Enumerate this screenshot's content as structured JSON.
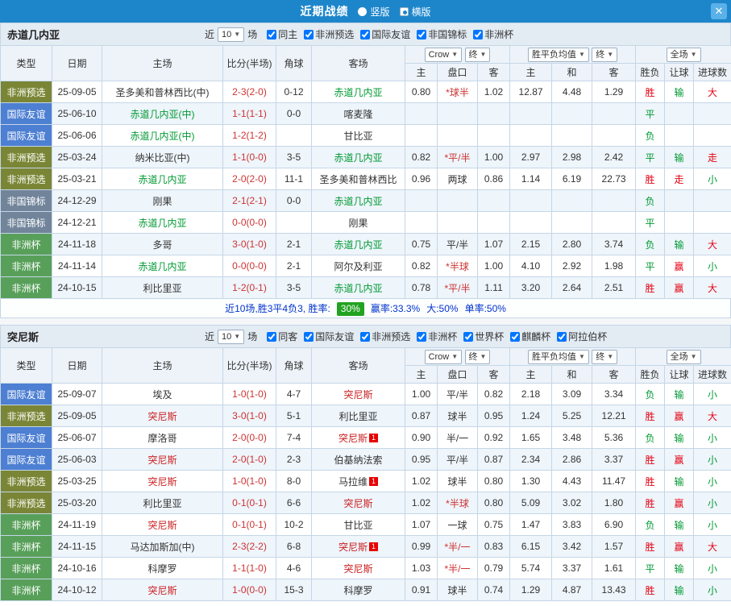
{
  "titlebar": {
    "title": "近期战绩",
    "layout_vertical": "竖版",
    "layout_horizontal": "横版",
    "close_icon": "✕"
  },
  "icons": {
    "caret": "▼"
  },
  "filter_bar": {
    "near": "近",
    "games": "场"
  },
  "head_controls": {
    "company": "Crow",
    "final_a": "终",
    "avg": "胜平负均值",
    "final_b": "终",
    "scope": "全场"
  },
  "table_head": {
    "type": "类型",
    "date": "日期",
    "home": "主场",
    "score": "比分(半场)",
    "corner": "角球",
    "away": "客场",
    "odds_home": "主",
    "odds_line": "盘口",
    "odds_away": "客",
    "euro_home": "主",
    "euro_draw": "和",
    "euro_away": "客",
    "result": "胜负",
    "handicap": "让球",
    "goals": "进球数"
  },
  "type_colors": {
    "非洲预选": "#7a8636",
    "国际友谊": "#4d7fd2",
    "非国锦标": "#71849a",
    "非洲杯": "#58a05a"
  },
  "result_colors": {
    "r": "#e60012",
    "g": "#009933"
  },
  "sections": [
    {
      "team": "赤道几内亚",
      "team_color": "#009933",
      "near_count": "10",
      "filters": [
        {
          "label": "同主",
          "checked": true
        },
        {
          "label": "非洲预选",
          "checked": true
        },
        {
          "label": "国际友谊",
          "checked": true
        },
        {
          "label": "非国锦标",
          "checked": true
        },
        {
          "label": "非洲杯",
          "checked": true
        }
      ],
      "rows": [
        {
          "type": "非洲预选",
          "date": "25-09-05",
          "home": "圣多美和普林西比(中)",
          "score": "2-3(2-0)",
          "corner": "0-12",
          "away": "赤道几内亚",
          "away_focal": true,
          "o1": "0.80",
          "line": "*球半",
          "line_red": true,
          "o2": "1.02",
          "e1": "12.87",
          "e2": "4.48",
          "e3": "1.29",
          "res": "胜",
          "res_c": "r",
          "handi": "输",
          "handi_c": "g",
          "goal": "大",
          "goal_c": "r"
        },
        {
          "type": "国际友谊",
          "date": "25-06-10",
          "home": "赤道几内亚(中)",
          "home_focal": true,
          "score": "1-1(1-1)",
          "corner": "0-0",
          "away": "喀麦隆",
          "o1": "",
          "line": "",
          "o2": "",
          "e1": "",
          "e2": "",
          "e3": "",
          "res": "平",
          "res_c": "g",
          "handi": "",
          "goal": ""
        },
        {
          "type": "国际友谊",
          "date": "25-06-06",
          "home": "赤道几内亚(中)",
          "home_focal": true,
          "score": "1-2(1-2)",
          "corner": "",
          "away": "甘比亚",
          "o1": "",
          "line": "",
          "o2": "",
          "e1": "",
          "e2": "",
          "e3": "",
          "res": "负",
          "res_c": "g",
          "handi": "",
          "goal": ""
        },
        {
          "type": "非洲预选",
          "date": "25-03-24",
          "home": "纳米比亚(中)",
          "score": "1-1(0-0)",
          "corner": "3-5",
          "away": "赤道几内亚",
          "away_focal": true,
          "o1": "0.82",
          "line": "*平/半",
          "line_red": true,
          "o2": "1.00",
          "e1": "2.97",
          "e2": "2.98",
          "e3": "2.42",
          "res": "平",
          "res_c": "g",
          "handi": "输",
          "handi_c": "g",
          "goal": "走",
          "goal_c": "r"
        },
        {
          "type": "非洲预选",
          "date": "25-03-21",
          "home": "赤道几内亚",
          "home_focal": true,
          "score": "2-0(2-0)",
          "corner": "11-1",
          "away": "圣多美和普林西比",
          "o1": "0.96",
          "line": "两球",
          "o2": "0.86",
          "e1": "1.14",
          "e2": "6.19",
          "e3": "22.73",
          "res": "胜",
          "res_c": "r",
          "handi": "走",
          "handi_c": "r",
          "goal": "小",
          "goal_c": "g"
        },
        {
          "type": "非国锦标",
          "date": "24-12-29",
          "home": "刚果",
          "score": "2-1(2-1)",
          "corner": "0-0",
          "away": "赤道几内亚",
          "away_focal": true,
          "o1": "",
          "line": "",
          "o2": "",
          "e1": "",
          "e2": "",
          "e3": "",
          "res": "负",
          "res_c": "g",
          "handi": "",
          "goal": ""
        },
        {
          "type": "非国锦标",
          "date": "24-12-21",
          "home": "赤道几内亚",
          "home_focal": true,
          "score": "0-0(0-0)",
          "corner": "",
          "away": "刚果",
          "o1": "",
          "line": "",
          "o2": "",
          "e1": "",
          "e2": "",
          "e3": "",
          "res": "平",
          "res_c": "g",
          "handi": "",
          "goal": ""
        },
        {
          "type": "非洲杯",
          "date": "24-11-18",
          "home": "多哥",
          "score": "3-0(1-0)",
          "corner": "2-1",
          "away": "赤道几内亚",
          "away_focal": true,
          "o1": "0.75",
          "line": "平/半",
          "o2": "1.07",
          "e1": "2.15",
          "e2": "2.80",
          "e3": "3.74",
          "res": "负",
          "res_c": "g",
          "handi": "输",
          "handi_c": "g",
          "goal": "大",
          "goal_c": "r"
        },
        {
          "type": "非洲杯",
          "date": "24-11-14",
          "home": "赤道几内亚",
          "home_focal": true,
          "score": "0-0(0-0)",
          "corner": "2-1",
          "away": "阿尔及利亚",
          "o1": "0.82",
          "line": "*半球",
          "line_red": true,
          "o2": "1.00",
          "e1": "4.10",
          "e2": "2.92",
          "e3": "1.98",
          "res": "平",
          "res_c": "g",
          "handi": "赢",
          "handi_c": "r",
          "goal": "小",
          "goal_c": "g"
        },
        {
          "type": "非洲杯",
          "date": "24-10-15",
          "home": "利比里亚",
          "score": "1-2(0-1)",
          "corner": "3-5",
          "away": "赤道几内亚",
          "away_focal": true,
          "o1": "0.78",
          "line": "*平/半",
          "line_red": true,
          "o2": "1.11",
          "e1": "3.20",
          "e2": "2.64",
          "e3": "2.51",
          "res": "胜",
          "res_c": "r",
          "handi": "赢",
          "handi_c": "r",
          "goal": "大",
          "goal_c": "r"
        }
      ],
      "summary": {
        "record": "近10场,胜3平4负3, 胜率:",
        "win_rate": "30%",
        "odds_rate": "赢率:33.3%",
        "big_rate": "大:50%",
        "single_rate": "单率:50%"
      }
    },
    {
      "team": "突尼斯",
      "team_color": "#cc2222",
      "near_count": "10",
      "filters": [
        {
          "label": "同客",
          "checked": true
        },
        {
          "label": "国际友谊",
          "checked": true
        },
        {
          "label": "非洲预选",
          "checked": true
        },
        {
          "label": "非洲杯",
          "checked": true
        },
        {
          "label": "世界杯",
          "checked": true
        },
        {
          "label": "麒麟杯",
          "checked": true
        },
        {
          "label": "阿拉伯杯",
          "checked": true
        }
      ],
      "rows": [
        {
          "type": "国际友谊",
          "date": "25-09-07",
          "home": "埃及",
          "score": "1-0(1-0)",
          "corner": "4-7",
          "away": "突尼斯",
          "away_focal": true,
          "o1": "1.00",
          "line": "平/半",
          "o2": "0.82",
          "e1": "2.18",
          "e2": "3.09",
          "e3": "3.34",
          "res": "负",
          "res_c": "g",
          "handi": "输",
          "handi_c": "g",
          "goal": "小",
          "goal_c": "g"
        },
        {
          "type": "非洲预选",
          "date": "25-09-05",
          "home": "突尼斯",
          "home_focal": true,
          "score": "3-0(1-0)",
          "corner": "5-1",
          "away": "利比里亚",
          "o1": "0.87",
          "line": "球半",
          "o2": "0.95",
          "e1": "1.24",
          "e2": "5.25",
          "e3": "12.21",
          "res": "胜",
          "res_c": "r",
          "handi": "赢",
          "handi_c": "r",
          "goal": "大",
          "goal_c": "r"
        },
        {
          "type": "国际友谊",
          "date": "25-06-07",
          "home": "摩洛哥",
          "score": "2-0(0-0)",
          "corner": "7-4",
          "away": "突尼斯",
          "away_focal": true,
          "away_card": "1",
          "o1": "0.90",
          "line": "半/一",
          "o2": "0.92",
          "e1": "1.65",
          "e2": "3.48",
          "e3": "5.36",
          "res": "负",
          "res_c": "g",
          "handi": "输",
          "handi_c": "g",
          "goal": "小",
          "goal_c": "g"
        },
        {
          "type": "国际友谊",
          "date": "25-06-03",
          "home": "突尼斯",
          "home_focal": true,
          "score": "2-0(1-0)",
          "corner": "2-3",
          "away": "伯基纳法索",
          "o1": "0.95",
          "line": "平/半",
          "o2": "0.87",
          "e1": "2.34",
          "e2": "2.86",
          "e3": "3.37",
          "res": "胜",
          "res_c": "r",
          "handi": "赢",
          "handi_c": "r",
          "goal": "小",
          "goal_c": "g"
        },
        {
          "type": "非洲预选",
          "date": "25-03-25",
          "home": "突尼斯",
          "home_focal": true,
          "score": "1-0(1-0)",
          "corner": "8-0",
          "away": "马拉维",
          "away_card": "1",
          "o1": "1.02",
          "line": "球半",
          "o2": "0.80",
          "e1": "1.30",
          "e2": "4.43",
          "e3": "11.47",
          "res": "胜",
          "res_c": "r",
          "handi": "输",
          "handi_c": "g",
          "goal": "小",
          "goal_c": "g"
        },
        {
          "type": "非洲预选",
          "date": "25-03-20",
          "home": "利比里亚",
          "score": "0-1(0-1)",
          "corner": "6-6",
          "away": "突尼斯",
          "away_focal": true,
          "o1": "1.02",
          "line": "*半球",
          "line_red": true,
          "o2": "0.80",
          "e1": "5.09",
          "e2": "3.02",
          "e3": "1.80",
          "res": "胜",
          "res_c": "r",
          "handi": "赢",
          "handi_c": "r",
          "goal": "小",
          "goal_c": "g"
        },
        {
          "type": "非洲杯",
          "date": "24-11-19",
          "home": "突尼斯",
          "home_focal": true,
          "score": "0-1(0-1)",
          "corner": "10-2",
          "away": "甘比亚",
          "o1": "1.07",
          "line": "一球",
          "o2": "0.75",
          "e1": "1.47",
          "e2": "3.83",
          "e3": "6.90",
          "res": "负",
          "res_c": "g",
          "handi": "输",
          "handi_c": "g",
          "goal": "小",
          "goal_c": "g"
        },
        {
          "type": "非洲杯",
          "date": "24-11-15",
          "home": "马达加斯加(中)",
          "score": "2-3(2-2)",
          "corner": "6-8",
          "away": "突尼斯",
          "away_focal": true,
          "away_card": "1",
          "o1": "0.99",
          "line": "*半/一",
          "line_red": true,
          "o2": "0.83",
          "e1": "6.15",
          "e2": "3.42",
          "e3": "1.57",
          "res": "胜",
          "res_c": "r",
          "handi": "赢",
          "handi_c": "r",
          "goal": "大",
          "goal_c": "r"
        },
        {
          "type": "非洲杯",
          "date": "24-10-16",
          "home": "科摩罗",
          "score": "1-1(1-0)",
          "corner": "4-6",
          "away": "突尼斯",
          "away_focal": true,
          "o1": "1.03",
          "line": "*半/一",
          "line_red": true,
          "o2": "0.79",
          "e1": "5.74",
          "e2": "3.37",
          "e3": "1.61",
          "res": "平",
          "res_c": "g",
          "handi": "输",
          "handi_c": "g",
          "goal": "小",
          "goal_c": "g"
        },
        {
          "type": "非洲杯",
          "date": "24-10-12",
          "home": "突尼斯",
          "home_focal": true,
          "score": "1-0(0-0)",
          "corner": "15-3",
          "away": "科摩罗",
          "o1": "0.91",
          "line": "球半",
          "o2": "0.74",
          "e1": "1.29",
          "e2": "4.87",
          "e3": "13.43",
          "res": "胜",
          "res_c": "r",
          "handi": "输",
          "handi_c": "g",
          "goal": "小",
          "goal_c": "g"
        }
      ]
    }
  ]
}
